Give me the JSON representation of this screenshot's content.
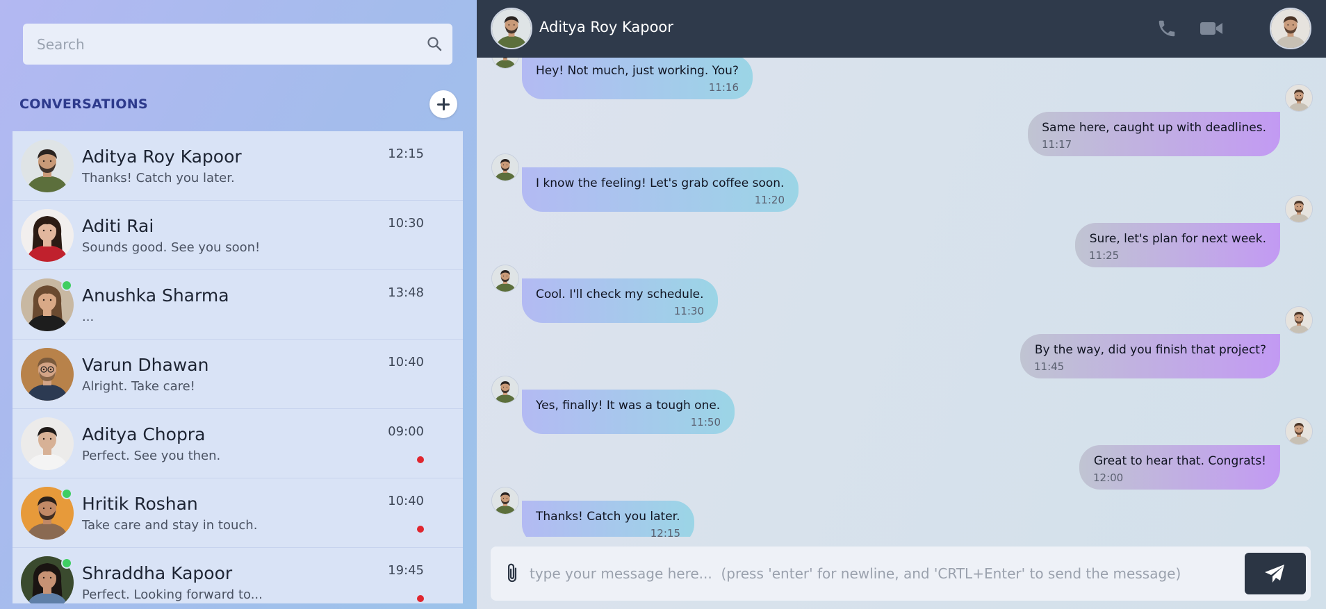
{
  "search": {
    "placeholder": "Search"
  },
  "conversations_title": "CONVERSATIONS",
  "conversations": [
    {
      "name": "Aditya Roy Kapoor",
      "time": "12:15",
      "preview": "Thanks! Catch you later.",
      "online": false,
      "unread": false,
      "avatar": "man-beard-green-jacket"
    },
    {
      "name": "Aditi Rai",
      "time": "10:30",
      "preview": "Sounds good. See you soon!",
      "online": false,
      "unread": false,
      "avatar": "woman-red-top"
    },
    {
      "name": "Anushka Sharma",
      "time": "13:48",
      "preview": "...",
      "online": true,
      "unread": false,
      "avatar": "woman-curly-hair"
    },
    {
      "name": "Varun Dhawan",
      "time": "10:40",
      "preview": "Alright. Take care!",
      "online": false,
      "unread": false,
      "avatar": "man-glasses-beard"
    },
    {
      "name": "Aditya Chopra",
      "time": "09:00",
      "preview": "Perfect. See you then.",
      "online": false,
      "unread": true,
      "avatar": "man-white-shirt"
    },
    {
      "name": "Hritik Roshan",
      "time": "10:40",
      "preview": "Take care and stay in touch.",
      "online": true,
      "unread": true,
      "avatar": "man-smiling-plaid"
    },
    {
      "name": "Shraddha Kapoor",
      "time": "19:45",
      "preview": "Perfect. Looking forward to...",
      "online": true,
      "unread": true,
      "avatar": "woman-denim"
    }
  ],
  "chat": {
    "contact_name": "Aditya Roy Kapoor",
    "messages": [
      {
        "dir": "in",
        "text": "Hey! Not much, just working. You?",
        "time": "11:16"
      },
      {
        "dir": "out",
        "text": "Same here, caught up with deadlines.",
        "time": "11:17"
      },
      {
        "dir": "in",
        "text": "I know the feeling! Let's grab coffee soon.",
        "time": "11:20"
      },
      {
        "dir": "out",
        "text": "Sure, let's plan for next week.",
        "time": "11:25"
      },
      {
        "dir": "in",
        "text": "Cool. I'll check my schedule.",
        "time": "11:30"
      },
      {
        "dir": "out",
        "text": "By the way, did you finish that project?",
        "time": "11:45"
      },
      {
        "dir": "in",
        "text": "Yes, finally! It was a tough one.",
        "time": "11:50"
      },
      {
        "dir": "out",
        "text": "Great to hear that. Congrats!",
        "time": "12:00"
      },
      {
        "dir": "in",
        "text": "Thanks! Catch you later.",
        "time": "12:15"
      }
    ],
    "composer_placeholder": "type your message here...  (press 'enter' for newline, and 'CRTL+Enter' to send the message)"
  },
  "icons": [
    "search-icon",
    "plus-icon",
    "phone-icon",
    "video-icon",
    "paperclip-icon",
    "send-icon"
  ],
  "colors": {
    "header_bg": "#2f3a4b",
    "accent_title": "#2d3a8c",
    "online": "#3fce62",
    "unread": "#e0262f"
  }
}
